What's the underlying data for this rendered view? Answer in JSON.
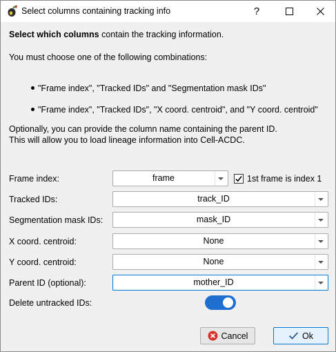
{
  "window": {
    "title": "Select columns containing tracking info",
    "help_glyph": "?",
    "maximize_glyph": "☐",
    "close_glyph": "✕"
  },
  "intro": {
    "heading_bold": "Select which columns",
    "heading_rest": "contain the tracking information.",
    "combos_intro": "You must choose one of the following combinations:",
    "bullets": [
      "\"Frame index\", \"Tracked IDs\" and \"Segmentation mask IDs\"",
      "\"Frame index\", \"Tracked IDs\", \"X coord. centroid\", and \"Y coord. centroid\""
    ],
    "optional_line1": "Optionally, you can provide the column name containing the parent ID.",
    "optional_line2": "This will allow you to load lineage information into Cell-ACDC."
  },
  "form": {
    "frame_index": {
      "label": "Frame index:",
      "value": "frame"
    },
    "first_frame_checkbox": {
      "label": "1st frame is index 1",
      "checked": true,
      "check_glyph": "✓"
    },
    "tracked_ids": {
      "label": "Tracked IDs:",
      "value": "track_ID"
    },
    "seg_mask_ids": {
      "label": "Segmentation mask IDs:",
      "value": "mask_ID"
    },
    "x_centroid": {
      "label": "X coord. centroid:",
      "value": "None"
    },
    "y_centroid": {
      "label": "Y coord. centroid:",
      "value": "None"
    },
    "parent_id": {
      "label": "Parent ID (optional):",
      "value": "mother_ID"
    },
    "delete_untracked": {
      "label": "Delete untracked IDs:",
      "on": true
    }
  },
  "buttons": {
    "cancel": "Cancel",
    "ok": "Ok"
  },
  "colors": {
    "accent": "#0078d7",
    "toggle_on": "#1f6fd1",
    "cancel_icon": "#d9342b",
    "ok_check": "#2f5c8a"
  }
}
